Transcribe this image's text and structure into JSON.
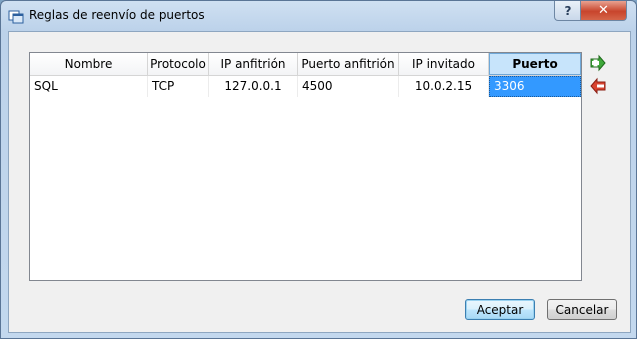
{
  "window": {
    "title": "Reglas de reenvío de puertos",
    "help_label": "?",
    "close_label": "✕"
  },
  "table": {
    "columns": [
      "Nombre",
      "Protocolo",
      "IP anfitrión",
      "Puerto anfitrión",
      "IP invitado",
      "Puerto invitado"
    ],
    "selected_column": "Puerto invitado",
    "rows": [
      [
        "SQL",
        "TCP",
        "127.0.0.1",
        "4500",
        "10.0.2.15",
        "3306"
      ]
    ]
  },
  "side_actions": {
    "add_icon": "add-rule-icon",
    "remove_icon": "remove-rule-icon"
  },
  "footer": {
    "accept_label": "Aceptar",
    "cancel_label": "Cancelar"
  },
  "colors": {
    "selection": "#3399ff",
    "add_green": "#3fa83a",
    "remove_red": "#d8432f"
  }
}
